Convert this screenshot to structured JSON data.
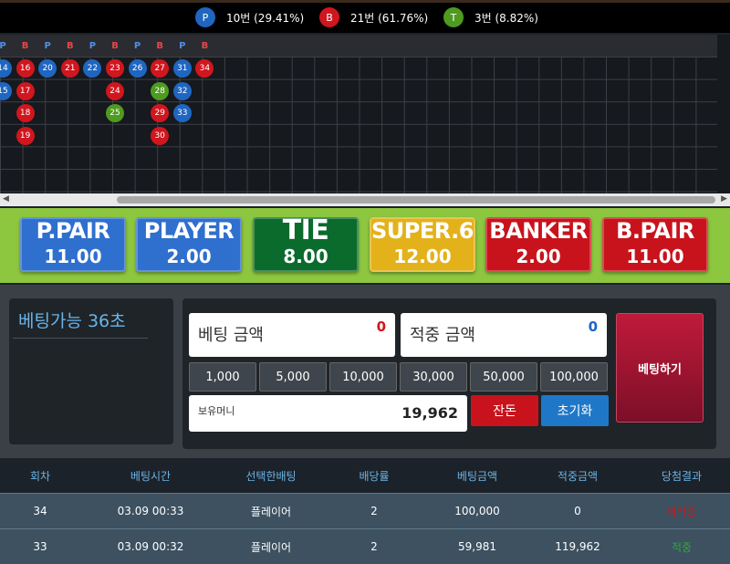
{
  "stats": {
    "player": {
      "icon": "P",
      "text": "10번 (29.41%)",
      "color": "#1f66c1"
    },
    "banker": {
      "icon": "B",
      "text": "21번 (61.76%)",
      "color": "#d0161e"
    },
    "tie": {
      "icon": "T",
      "text": "3번 (8.82%)",
      "color": "#4e9b1f"
    }
  },
  "board": {
    "header": [
      "P",
      "B",
      "P",
      "B",
      "P",
      "B",
      "P",
      "B",
      "P",
      "B"
    ],
    "beads": [
      {
        "n": "14",
        "c": "P",
        "col": 0,
        "row": 0
      },
      {
        "n": "15",
        "c": "P",
        "col": 0,
        "row": 1
      },
      {
        "n": "16",
        "c": "B",
        "col": 1,
        "row": 0
      },
      {
        "n": "17",
        "c": "B",
        "col": 1,
        "row": 1
      },
      {
        "n": "18",
        "c": "B",
        "col": 1,
        "row": 2
      },
      {
        "n": "19",
        "c": "B",
        "col": 1,
        "row": 3
      },
      {
        "n": "20",
        "c": "P",
        "col": 2,
        "row": 0
      },
      {
        "n": "21",
        "c": "B",
        "col": 3,
        "row": 0
      },
      {
        "n": "22",
        "c": "P",
        "col": 4,
        "row": 0
      },
      {
        "n": "23",
        "c": "B",
        "col": 5,
        "row": 0
      },
      {
        "n": "24",
        "c": "B",
        "col": 5,
        "row": 1
      },
      {
        "n": "25",
        "c": "T",
        "col": 5,
        "row": 2
      },
      {
        "n": "26",
        "c": "P",
        "col": 6,
        "row": 0
      },
      {
        "n": "27",
        "c": "B",
        "col": 7,
        "row": 0
      },
      {
        "n": "28",
        "c": "T",
        "col": 7,
        "row": 1
      },
      {
        "n": "29",
        "c": "B",
        "col": 7,
        "row": 2
      },
      {
        "n": "30",
        "c": "B",
        "col": 7,
        "row": 3
      },
      {
        "n": "31",
        "c": "P",
        "col": 8,
        "row": 0
      },
      {
        "n": "32",
        "c": "P",
        "col": 8,
        "row": 1
      },
      {
        "n": "33",
        "c": "P",
        "col": 8,
        "row": 2
      },
      {
        "n": "34",
        "c": "B",
        "col": 9,
        "row": 0
      }
    ],
    "colors": {
      "P": "#1f66c1",
      "B": "#d0161e",
      "T": "#4e9b1f"
    }
  },
  "bets": [
    {
      "name": "P.PAIR",
      "odds": "11.00",
      "color": "#2f6fce"
    },
    {
      "name": "PLAYER",
      "odds": "2.00",
      "color": "#2f6fce"
    },
    {
      "name": "TIE",
      "odds": "8.00",
      "color": "#0b6b2d"
    },
    {
      "name": "SUPER.6",
      "odds": "12.00",
      "color": "#e3b21a"
    },
    {
      "name": "BANKER",
      "odds": "2.00",
      "color": "#c8131c"
    },
    {
      "name": "B.PAIR",
      "odds": "11.00",
      "color": "#c8131c"
    }
  ],
  "timer": {
    "label": "베팅가능 36초"
  },
  "form": {
    "bet_label": "베팅 금액",
    "bet_value": "0",
    "win_label": "적중 금액",
    "win_value": "0",
    "chips": [
      "1,000",
      "5,000",
      "10,000",
      "30,000",
      "50,000",
      "100,000"
    ],
    "balance_label": "보유머니",
    "balance_value": "19,962",
    "change_label": "잔돈",
    "reset_label": "초기화",
    "place_label": "베팅하기"
  },
  "table": {
    "headers": [
      "회차",
      "베팅시간",
      "선택한배팅",
      "배당률",
      "베팅금액",
      "적중금액",
      "당첨결과"
    ],
    "rows": [
      [
        "34",
        "03.09 00:33",
        "플레이어",
        "2",
        "100,000",
        "0",
        "미적중"
      ],
      [
        "33",
        "03.09 00:32",
        "플레이어",
        "2",
        "59,981",
        "119,962",
        "적중"
      ]
    ],
    "result_colors": {
      "miss": "#d0161e",
      "hit": "#2faa3a"
    }
  }
}
